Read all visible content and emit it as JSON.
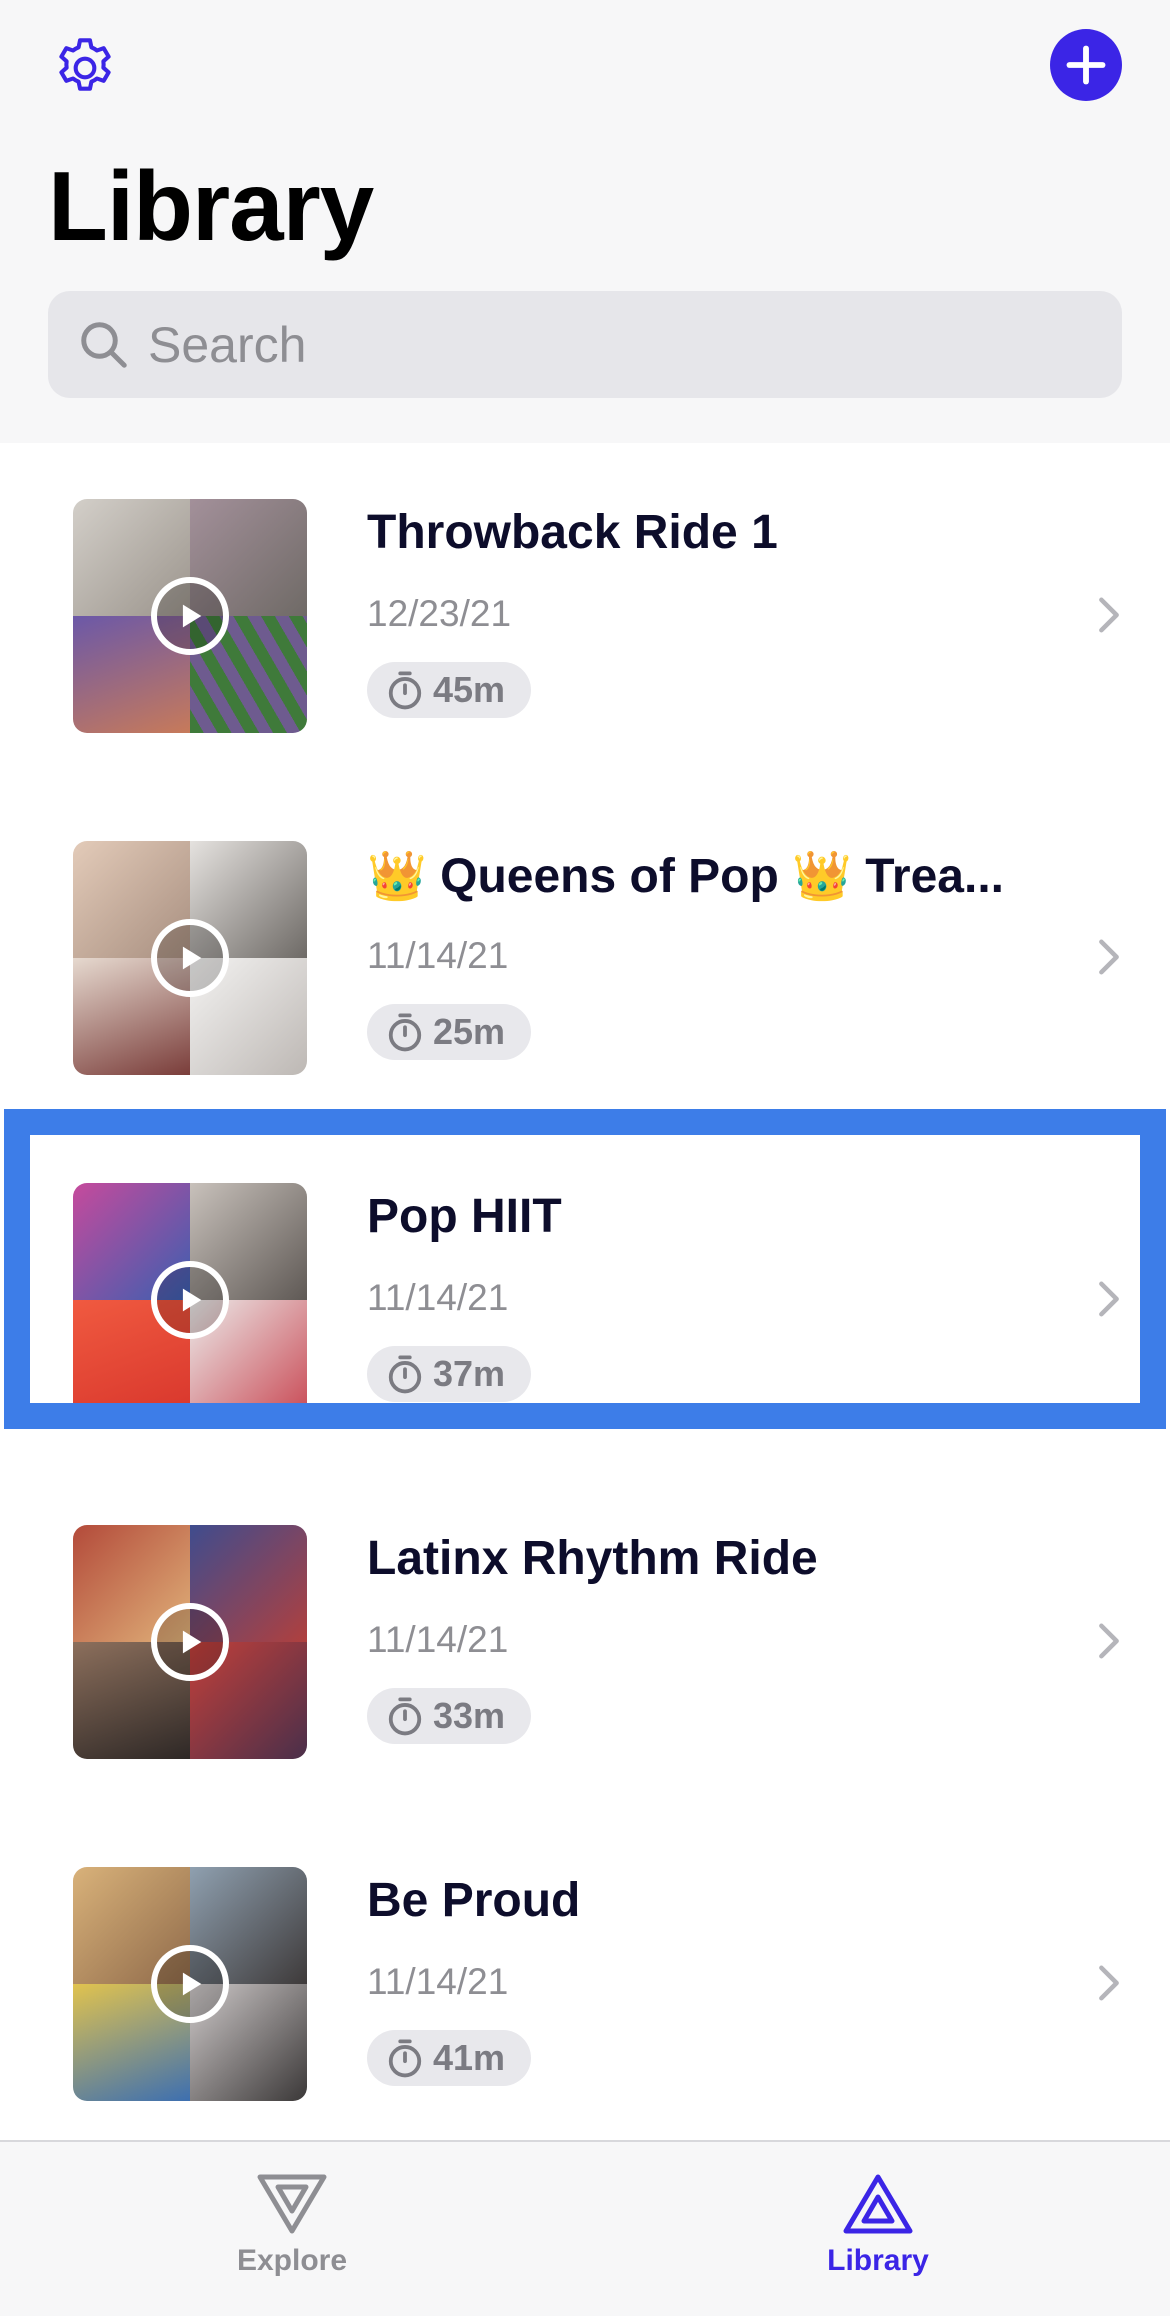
{
  "header": {
    "title": "Library",
    "settings_icon": "gear-icon",
    "add_icon": "plus-icon",
    "accent_color": "#3b25e6"
  },
  "search": {
    "placeholder": "Search",
    "icon": "search-icon"
  },
  "playlists": [
    {
      "title": "Throwback Ride 1",
      "date": "12/23/21",
      "duration": "45m",
      "selected": false,
      "art_colors": [
        "#b9b4ad",
        "#8a7c80",
        "#6a4e86",
        "#3b6b3a"
      ]
    },
    {
      "title": "👑 Queens of Pop 👑 Trea...",
      "date": "11/14/21",
      "duration": "25m",
      "selected": false,
      "art_colors": [
        "#d7bfae",
        "#b7b4b0",
        "#c7b3a4",
        "#e9e7e5"
      ]
    },
    {
      "title": "Pop HIIT",
      "date": "11/14/21",
      "duration": "37m",
      "selected": true,
      "art_colors": [
        "#a8458e",
        "#b7aca4",
        "#e94b3c",
        "#e2dedc"
      ]
    },
    {
      "title": "Latinx Rhythm Ride",
      "date": "11/14/21",
      "duration": "33m",
      "selected": false,
      "art_colors": [
        "#a04a3f",
        "#5e4f8d",
        "#7a6252",
        "#b63a3a"
      ]
    },
    {
      "title": "Be Proud",
      "date": "11/14/21",
      "duration": "41m",
      "selected": false,
      "art_colors": [
        "#c8a06a",
        "#8a8f96",
        "#cfae4c",
        "#a9a4a4"
      ]
    }
  ],
  "tabbar": {
    "explore_label": "Explore",
    "library_label": "Library",
    "active_color": "#3b25e6",
    "inactive_color": "#8e8e93"
  }
}
